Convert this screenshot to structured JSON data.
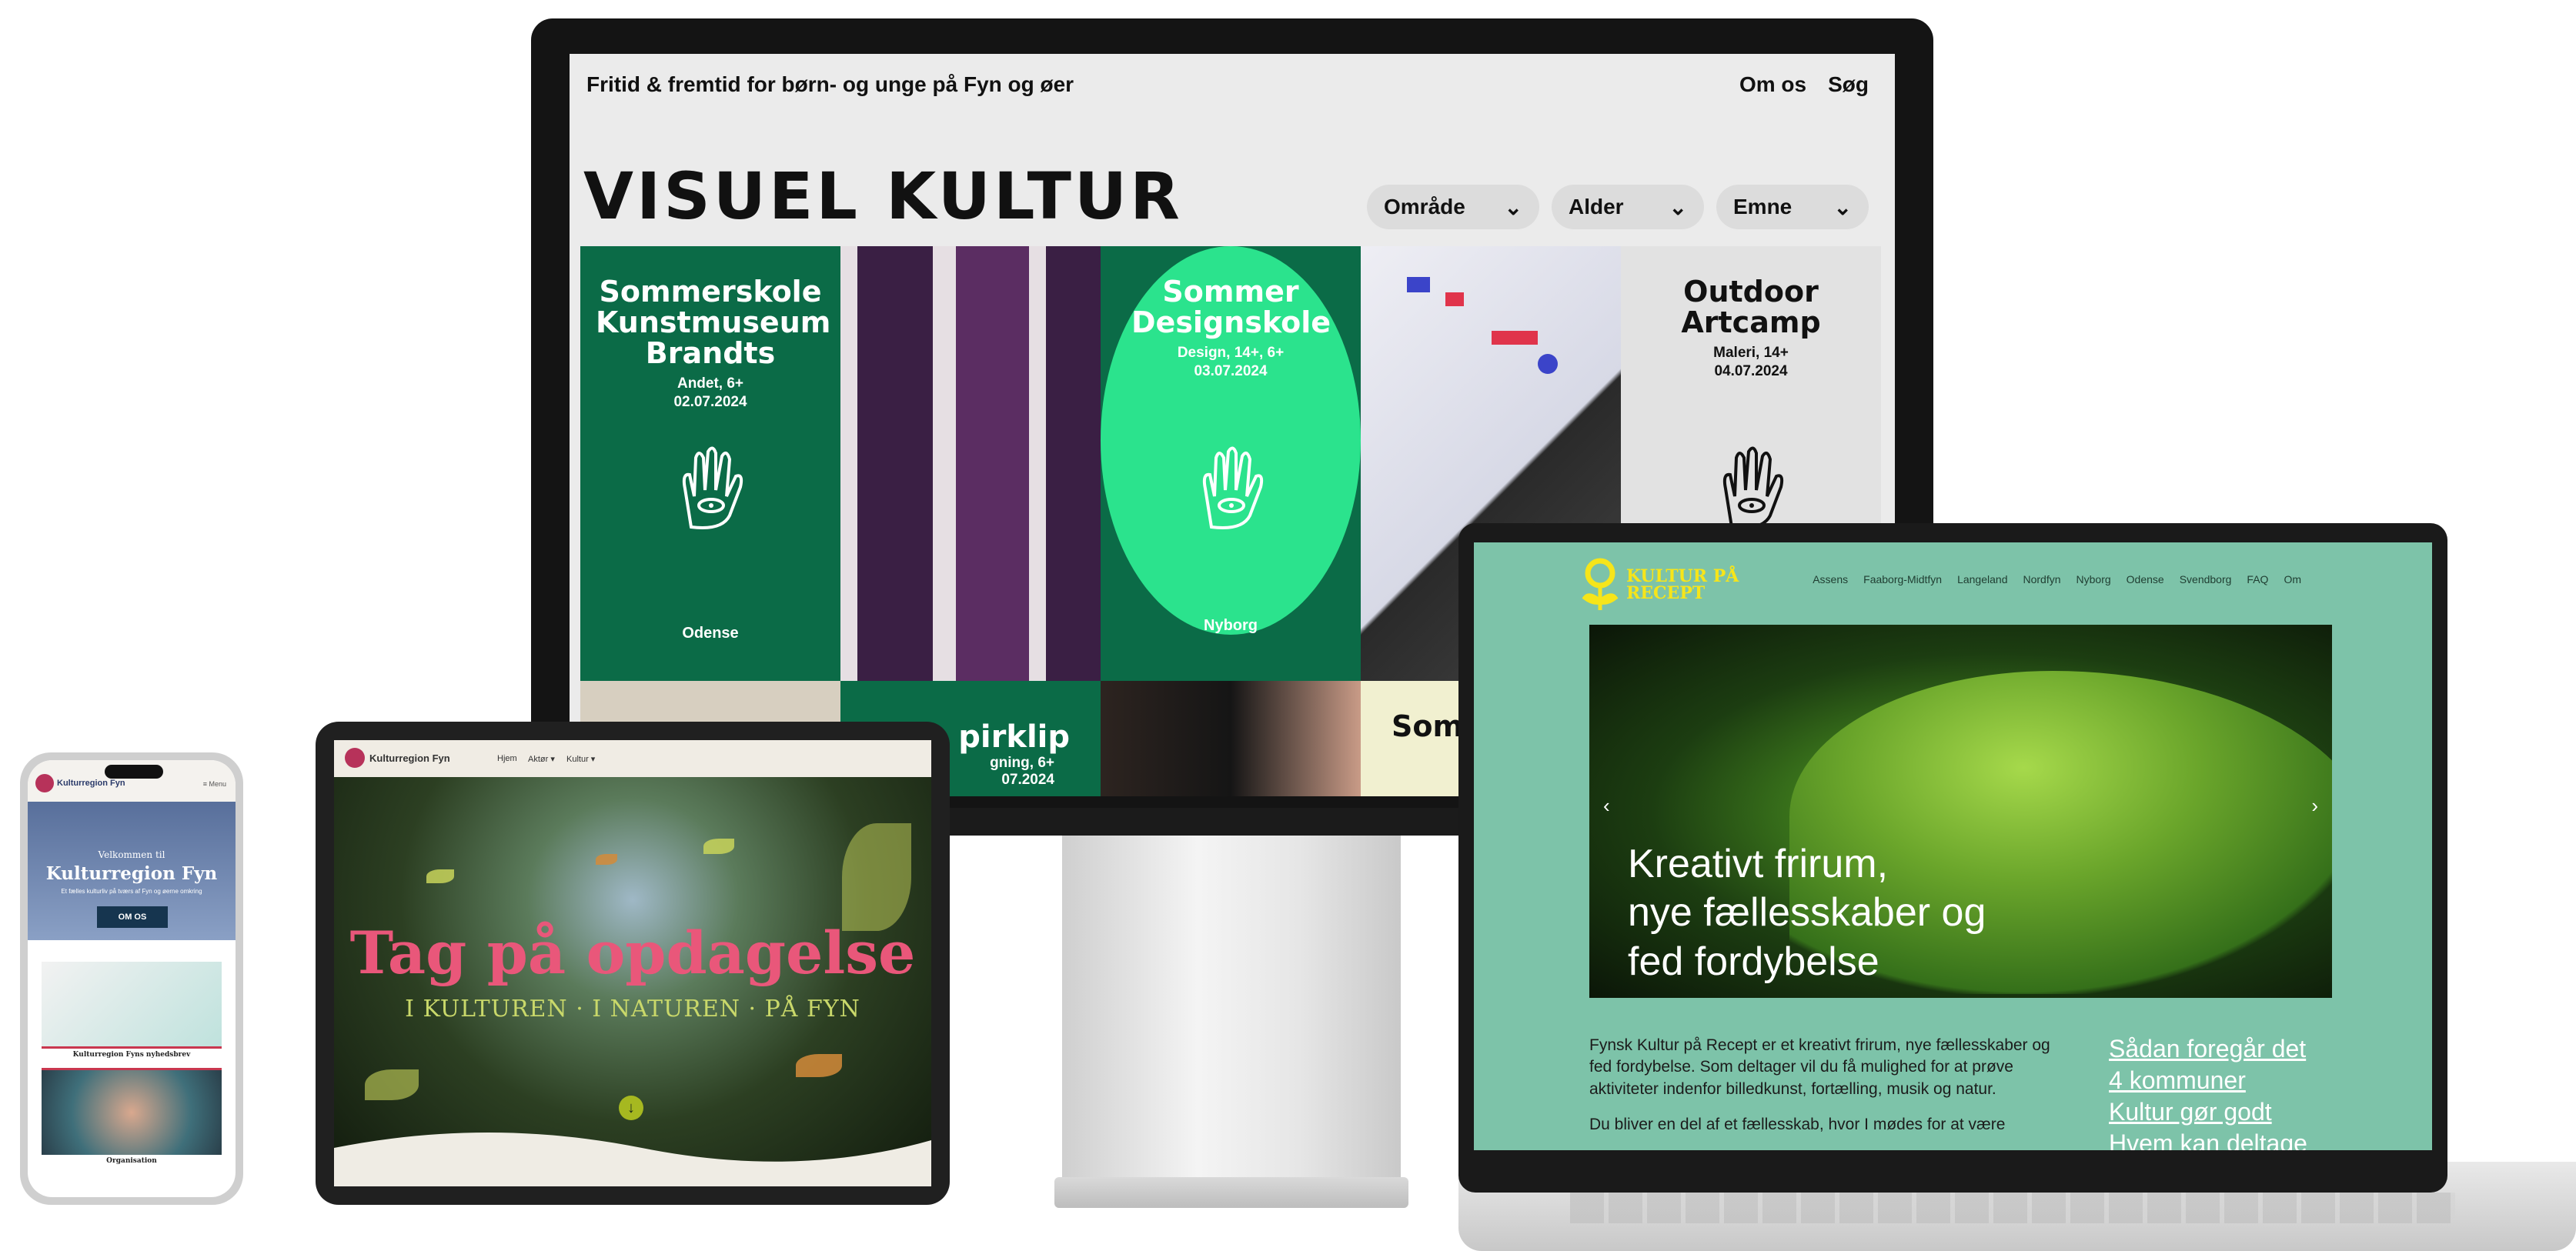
{
  "monitor": {
    "tagline": "Fritid & fremtid for børn- og unge på Fyn og øer",
    "nav": [
      "Om os",
      "Søg"
    ],
    "logo": "VISUEL KULTUR",
    "filters": [
      "Område",
      "Alder",
      "Emne"
    ],
    "tiles": [
      {
        "title": "Sommerskole Kunstmuseum Brandts",
        "meta": "Andet, 6+",
        "date": "02.07.2024",
        "city": "Odense"
      },
      {
        "title": "Sommer Designskole",
        "meta": "Design, 14+, 6+",
        "date": "03.07.2024",
        "city": "Nyborg"
      },
      {
        "title": "Outdoor Artcamp",
        "meta": "Maleri, 14+",
        "date": "04.07.2024",
        "city": ""
      },
      {
        "title": "pirklip",
        "meta": "gning, 6+",
        "date": "07.2024",
        "city": ""
      },
      {
        "title": "Som Kuns B",
        "meta": "",
        "date": "",
        "city": ""
      }
    ],
    "colors": {
      "dark_green": "#0b6b47",
      "bright_green": "#2be38d",
      "screen_bg": "#ebebeb"
    }
  },
  "laptop": {
    "logo": "KULTUR PÅ RECEPT",
    "nav": [
      "Assens",
      "Faaborg-Midtfyn",
      "Langeland",
      "Nordfyn",
      "Nyborg",
      "Odense",
      "Svendborg",
      "FAQ",
      "Om"
    ],
    "headline_lines": [
      "Kreativt frirum,",
      "nye fællesskaber og",
      "fed fordybelse"
    ],
    "body_p1": "Fynsk Kultur på Recept er et kreativt frirum, nye fællesskaber og fed fordybelse. Som deltager vil du få mulighed for at prøve aktiviteter indenfor billedkunst, fortælling, musik og natur.",
    "body_p2": "Du bliver en del af et fællesskab, hvor I mødes for at være",
    "links": [
      "Sådan foregår det",
      "4 kommuner",
      "Kultur gør godt",
      "Hvem kan deltage"
    ],
    "arrow_left": "‹",
    "arrow_right": "›",
    "colors": {
      "bg": "#7dc3a9",
      "logo": "#f6e51a"
    }
  },
  "tablet": {
    "logo": "Kulturregion Fyn",
    "nav": [
      "Hjem",
      "Aktør ▾",
      "Kultur ▾"
    ],
    "title": "Tag på opdagelse",
    "subtitle": "I KULTUREN · I NATUREN · PÅ FYN",
    "down_icon": "↓",
    "colors": {
      "title": "#e9577a",
      "subtitle": "#c9d86a"
    }
  },
  "phone": {
    "logo": "Kulturregion Fyn",
    "menu": "≡ Menu",
    "welcome": "Velkommen til",
    "title": "Kulturregion Fyn",
    "tagline": "Et fælles kulturliv på tværs af Fyn og øerne omkring",
    "button": "OM OS",
    "card1": "Kulturregion Fyns nyhedsbrev",
    "card2": "Organisation"
  }
}
